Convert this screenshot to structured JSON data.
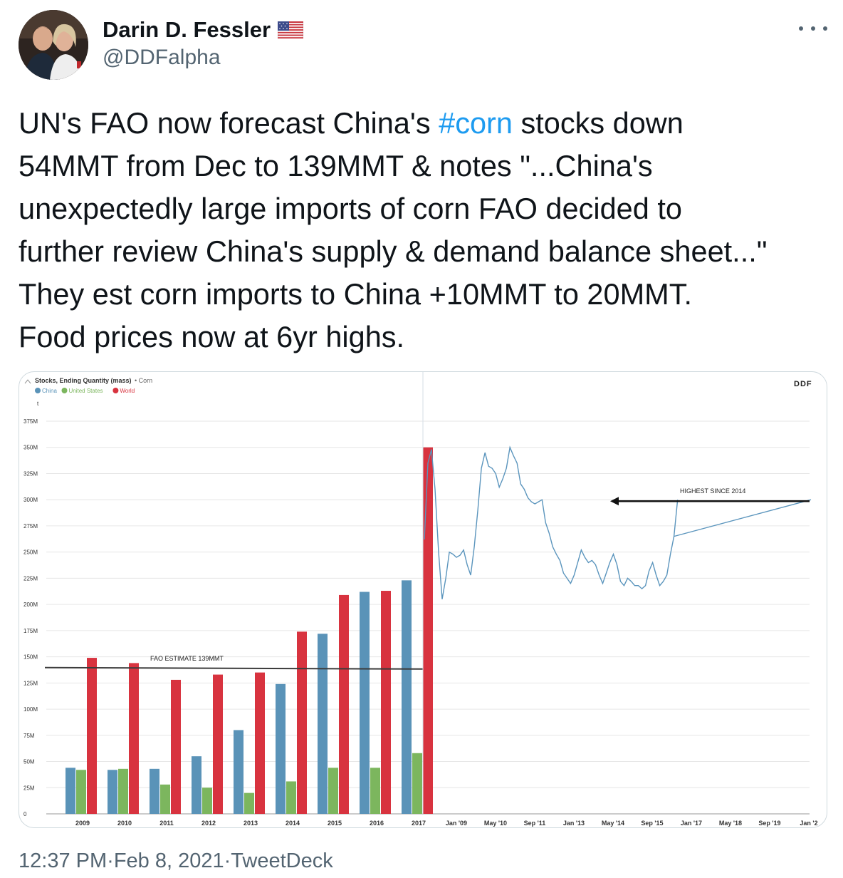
{
  "author": {
    "display_name": "Darin D. Fessler",
    "flag_icon": "us-flag-icon",
    "handle": "@DDFalpha",
    "more_icon": "more-horizontal-icon"
  },
  "tweet": {
    "text_part1": "UN's FAO now forecast China's ",
    "hashtag": "#corn",
    "text_part2": " stocks down\n54MMT from Dec to 139MMT & notes \"...China's\nunexpectedly large imports of corn FAO decided to\nfurther review China's supply & demand balance sheet...\"\nThey est corn imports to China +10MMT to 20MMT.\nFood prices now at 6yr highs.",
    "time": "12:37 PM",
    "separator": " · ",
    "date": "Feb 8, 2021",
    "client": "TweetDeck"
  },
  "chart_data": [
    {
      "type": "bar",
      "title": "Stocks, Ending Quantity (mass)",
      "subtitle": "• Corn",
      "ylabel": "t",
      "logo": "DDF",
      "legend_position": "top-left",
      "ylim": [
        0,
        375
      ],
      "yticks": [
        "0",
        "25M",
        "50M",
        "75M",
        "100M",
        "125M",
        "150M",
        "175M",
        "200M",
        "225M",
        "250M",
        "275M",
        "300M",
        "325M",
        "350M",
        "375M"
      ],
      "categories": [
        "2009",
        "2010",
        "2011",
        "2012",
        "2013",
        "2014",
        "2015",
        "2016",
        "2017"
      ],
      "series": [
        {
          "name": "China",
          "color": "#5a93b8",
          "values": [
            44,
            42,
            43,
            55,
            80,
            124,
            172,
            212,
            223
          ]
        },
        {
          "name": "United States",
          "color": "#7cb65e",
          "values": [
            42,
            43,
            28,
            25,
            20,
            31,
            44,
            44,
            58
          ]
        },
        {
          "name": "World",
          "color": "#d8333f",
          "values": [
            149,
            144,
            128,
            133,
            135,
            174,
            209,
            213,
            350
          ]
        }
      ],
      "annotation": {
        "label": "FAO ESTIMATE 139MMT",
        "value": 139
      }
    },
    {
      "type": "line",
      "color": "#5b95bd",
      "ylim": [
        0,
        375
      ],
      "xticks": [
        "Jan '09",
        "May '10",
        "Sep '11",
        "Jan '13",
        "May '14",
        "Sep '15",
        "Jan '17",
        "May '18",
        "Sep '19",
        "Jan '2"
      ],
      "x_index": [
        0,
        5,
        10,
        15,
        20,
        25,
        30,
        35,
        40,
        45,
        50,
        55,
        60,
        65,
        70,
        75,
        80,
        85,
        90,
        95,
        100,
        105,
        110,
        115,
        120,
        125,
        130,
        135,
        140,
        145,
        150,
        155,
        160,
        165,
        170,
        175,
        180,
        185,
        190,
        195,
        200,
        205,
        210,
        215,
        220,
        225,
        230,
        235,
        240,
        245,
        250,
        255,
        260,
        265,
        270,
        275,
        280,
        285,
        290,
        295,
        300,
        305,
        310,
        315,
        320,
        325,
        330,
        335,
        340,
        345,
        350,
        355,
        360,
        365,
        370,
        375,
        380,
        385,
        390,
        395,
        400,
        405,
        410,
        415,
        420,
        425,
        430,
        435,
        440,
        445,
        450,
        455,
        460,
        465,
        470,
        475,
        480,
        485,
        490,
        495,
        500,
        505,
        510,
        515,
        520,
        525,
        530,
        535,
        540
      ],
      "values": [
        262,
        335,
        348,
        310,
        250,
        205,
        225,
        250,
        248,
        245,
        247,
        252,
        238,
        228,
        255,
        290,
        330,
        345,
        332,
        330,
        325,
        312,
        320,
        330,
        350,
        342,
        335,
        315,
        310,
        302,
        298,
        296,
        298,
        300,
        278,
        268,
        255,
        248,
        242,
        230,
        225,
        220,
        228,
        240,
        252,
        245,
        240,
        242,
        238,
        228,
        220,
        230,
        240,
        248,
        238,
        222,
        218,
        225,
        222,
        218,
        218,
        215,
        218,
        232,
        240,
        228,
        218,
        222,
        228,
        248,
        265,
        300,
        300,
        300,
        300,
        300,
        300,
        300,
        300,
        300,
        300,
        300,
        300,
        300,
        300,
        300,
        300,
        300,
        300,
        300,
        300,
        300,
        300,
        300,
        300,
        300,
        300,
        300,
        300,
        300,
        300,
        300,
        300,
        300,
        300,
        300,
        300,
        300,
        300
      ],
      "annotation": {
        "label": "HIGHEST SINCE 2014",
        "value": 300
      }
    }
  ]
}
